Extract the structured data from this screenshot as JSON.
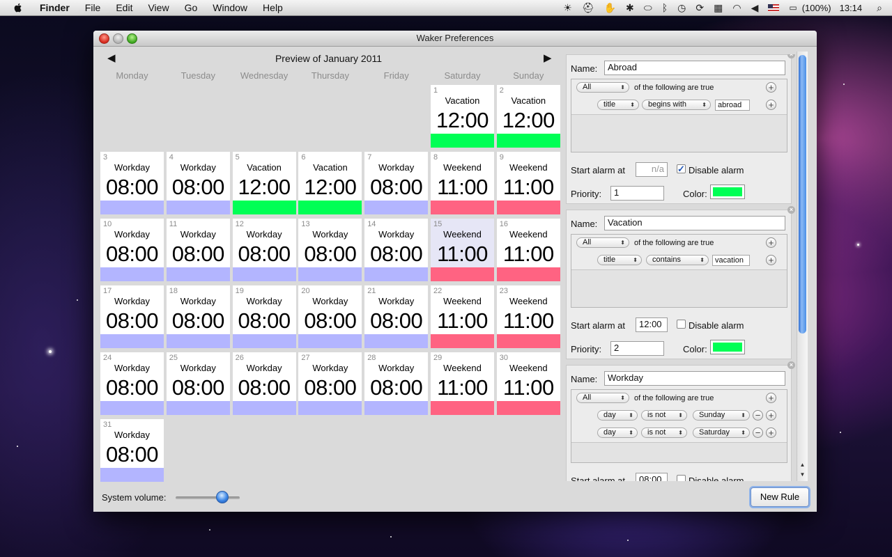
{
  "menubar": {
    "app": "Finder",
    "items": [
      "File",
      "Edit",
      "View",
      "Go",
      "Window",
      "Help"
    ],
    "battery": "(100%)",
    "clock": "13:14",
    "icons": [
      "apple-logo-icon",
      "sun-icon",
      "hat-icon",
      "hand-icon",
      "bug-icon",
      "drive-icon",
      "bluetooth-icon",
      "time-machine-icon",
      "sync-icon",
      "spaces-icon",
      "wifi-icon",
      "volume-icon",
      "flag-icon",
      "battery-icon",
      "spotlight-icon"
    ]
  },
  "window": {
    "title": "Waker Preferences"
  },
  "calendar": {
    "title": "Preview of January 2011",
    "prev": "◀",
    "next": "▶",
    "weekdays": [
      "Monday",
      "Tuesday",
      "Wednesday",
      "Thursday",
      "Friday",
      "Saturday",
      "Sunday"
    ],
    "days": [
      {
        "n": "1",
        "title": "Vacation",
        "time": "12:00",
        "color": "#00ff55"
      },
      {
        "n": "2",
        "title": "Vacation",
        "time": "12:00",
        "color": "#00ff55"
      },
      {
        "n": "3",
        "title": "Workday",
        "time": "08:00",
        "color": "#b3b5ff"
      },
      {
        "n": "4",
        "title": "Workday",
        "time": "08:00",
        "color": "#b3b5ff"
      },
      {
        "n": "5",
        "title": "Vacation",
        "time": "12:00",
        "color": "#00ff55"
      },
      {
        "n": "6",
        "title": "Vacation",
        "time": "12:00",
        "color": "#00ff55"
      },
      {
        "n": "7",
        "title": "Workday",
        "time": "08:00",
        "color": "#b3b5ff"
      },
      {
        "n": "8",
        "title": "Weekend",
        "time": "11:00",
        "color": "#ff6382"
      },
      {
        "n": "9",
        "title": "Weekend",
        "time": "11:00",
        "color": "#ff6382"
      },
      {
        "n": "10",
        "title": "Workday",
        "time": "08:00",
        "color": "#b3b5ff"
      },
      {
        "n": "11",
        "title": "Workday",
        "time": "08:00",
        "color": "#b3b5ff"
      },
      {
        "n": "12",
        "title": "Workday",
        "time": "08:00",
        "color": "#b3b5ff"
      },
      {
        "n": "13",
        "title": "Workday",
        "time": "08:00",
        "color": "#b3b5ff"
      },
      {
        "n": "14",
        "title": "Workday",
        "time": "08:00",
        "color": "#b3b5ff"
      },
      {
        "n": "15",
        "title": "Weekend",
        "time": "11:00",
        "color": "#ff6382",
        "highlight": true
      },
      {
        "n": "16",
        "title": "Weekend",
        "time": "11:00",
        "color": "#ff6382"
      },
      {
        "n": "17",
        "title": "Workday",
        "time": "08:00",
        "color": "#b3b5ff"
      },
      {
        "n": "18",
        "title": "Workday",
        "time": "08:00",
        "color": "#b3b5ff"
      },
      {
        "n": "19",
        "title": "Workday",
        "time": "08:00",
        "color": "#b3b5ff"
      },
      {
        "n": "20",
        "title": "Workday",
        "time": "08:00",
        "color": "#b3b5ff"
      },
      {
        "n": "21",
        "title": "Workday",
        "time": "08:00",
        "color": "#b3b5ff"
      },
      {
        "n": "22",
        "title": "Weekend",
        "time": "11:00",
        "color": "#ff6382"
      },
      {
        "n": "23",
        "title": "Weekend",
        "time": "11:00",
        "color": "#ff6382"
      },
      {
        "n": "24",
        "title": "Workday",
        "time": "08:00",
        "color": "#b3b5ff"
      },
      {
        "n": "25",
        "title": "Workday",
        "time": "08:00",
        "color": "#b3b5ff"
      },
      {
        "n": "26",
        "title": "Workday",
        "time": "08:00",
        "color": "#b3b5ff"
      },
      {
        "n": "27",
        "title": "Workday",
        "time": "08:00",
        "color": "#b3b5ff"
      },
      {
        "n": "28",
        "title": "Workday",
        "time": "08:00",
        "color": "#b3b5ff"
      },
      {
        "n": "29",
        "title": "Weekend",
        "time": "11:00",
        "color": "#ff6382"
      },
      {
        "n": "30",
        "title": "Weekend",
        "time": "11:00",
        "color": "#ff6382"
      },
      {
        "n": "31",
        "title": "Workday",
        "time": "08:00",
        "color": "#b3b5ff"
      }
    ],
    "first_weekday_index": 5
  },
  "bottom": {
    "volume_label": "System volume:",
    "volume_level": 0.72,
    "new_rule": "New Rule"
  },
  "rule_labels": {
    "name": "Name:",
    "match_suffix": "of the following are true",
    "start_alarm": "Start alarm at",
    "disable_alarm": "Disable alarm",
    "priority": "Priority:",
    "color": "Color:"
  },
  "rules": [
    {
      "name": "Abroad",
      "match": "All",
      "conditions": [
        {
          "field": "title",
          "op": "begins with",
          "value": "abroad"
        }
      ],
      "start_alarm": "n/a",
      "disable_alarm": true,
      "priority": "1",
      "color": "#00ff55"
    },
    {
      "name": "Vacation",
      "match": "All",
      "conditions": [
        {
          "field": "title",
          "op": "contains",
          "value": "vacation"
        }
      ],
      "start_alarm": "12:00",
      "disable_alarm": false,
      "priority": "2",
      "color": "#00ff55"
    },
    {
      "name": "Workday",
      "match": "All",
      "conditions": [
        {
          "field": "day",
          "op": "is not",
          "value": "Sunday",
          "removable": true
        },
        {
          "field": "day",
          "op": "is not",
          "value": "Saturday",
          "removable": true
        }
      ],
      "start_alarm": "08:00",
      "disable_alarm": false
    }
  ]
}
